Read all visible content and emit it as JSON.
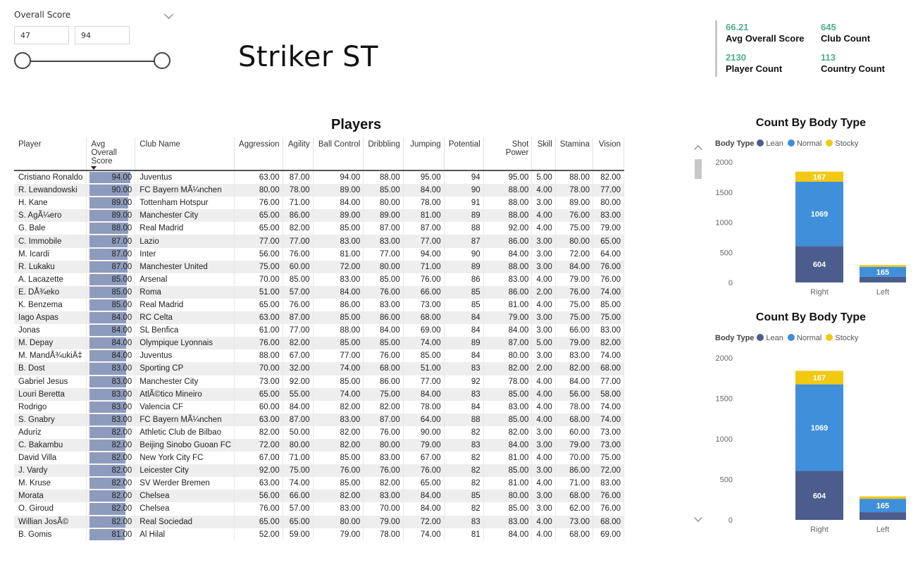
{
  "slicer": {
    "title": "Overall Score",
    "min": "47",
    "max": "94"
  },
  "page_title": "Striker ST",
  "kpis": [
    {
      "value": "66.21",
      "label": "Avg Overall Score"
    },
    {
      "value": "645",
      "label": "Club Count"
    },
    {
      "value": "2130",
      "label": "Player Count"
    },
    {
      "value": "113",
      "label": "Country Count"
    }
  ],
  "table": {
    "title": "Players",
    "score_max": 94,
    "columns": [
      "Player",
      "Avg Overall Score",
      "Club Name",
      "Aggression",
      "Agility",
      "Ball Control",
      "Dribbling",
      "Jumping",
      "Potential",
      "Shot Power",
      "Skill",
      "Stamina",
      "Vision"
    ],
    "rows": [
      [
        "Cristiano Ronaldo",
        "94.00",
        "Juventus",
        "63.00",
        "87.00",
        "94.00",
        "88.00",
        "95.00",
        "94",
        "95.00",
        "5.00",
        "88.00",
        "82.00"
      ],
      [
        "R. Lewandowski",
        "90.00",
        "FC Bayern MÃ¼nchen",
        "80.00",
        "78.00",
        "89.00",
        "85.00",
        "84.00",
        "90",
        "88.00",
        "4.00",
        "78.00",
        "77.00"
      ],
      [
        "H. Kane",
        "89.00",
        "Tottenham Hotspur",
        "76.00",
        "71.00",
        "84.00",
        "80.00",
        "78.00",
        "91",
        "88.00",
        "3.00",
        "89.00",
        "80.00"
      ],
      [
        "S. AgÃ¼ero",
        "89.00",
        "Manchester City",
        "65.00",
        "86.00",
        "89.00",
        "89.00",
        "81.00",
        "89",
        "88.00",
        "4.00",
        "76.00",
        "83.00"
      ],
      [
        "G. Bale",
        "88.00",
        "Real Madrid",
        "65.00",
        "82.00",
        "85.00",
        "87.00",
        "87.00",
        "88",
        "92.00",
        "4.00",
        "75.00",
        "79.00"
      ],
      [
        "C. Immobile",
        "87.00",
        "Lazio",
        "77.00",
        "77.00",
        "83.00",
        "83.00",
        "77.00",
        "87",
        "86.00",
        "3.00",
        "80.00",
        "65.00"
      ],
      [
        "M. Icardi",
        "87.00",
        "Inter",
        "56.00",
        "76.00",
        "81.00",
        "77.00",
        "94.00",
        "90",
        "84.00",
        "3.00",
        "72.00",
        "64.00"
      ],
      [
        "R. Lukaku",
        "87.00",
        "Manchester United",
        "75.00",
        "60.00",
        "72.00",
        "80.00",
        "71.00",
        "89",
        "88.00",
        "3.00",
        "84.00",
        "76.00"
      ],
      [
        "A. Lacazette",
        "85.00",
        "Arsenal",
        "70.00",
        "85.00",
        "83.00",
        "85.00",
        "76.00",
        "86",
        "83.00",
        "4.00",
        "79.00",
        "76.00"
      ],
      [
        "E. DÅ¾eko",
        "85.00",
        "Roma",
        "51.00",
        "57.00",
        "84.00",
        "76.00",
        "66.00",
        "85",
        "86.00",
        "2.00",
        "76.00",
        "74.00"
      ],
      [
        "K. Benzema",
        "85.00",
        "Real Madrid",
        "65.00",
        "76.00",
        "86.00",
        "83.00",
        "73.00",
        "85",
        "81.00",
        "4.00",
        "75.00",
        "85.00"
      ],
      [
        "Iago Aspas",
        "84.00",
        "RC Celta",
        "63.00",
        "87.00",
        "85.00",
        "86.00",
        "68.00",
        "84",
        "79.00",
        "3.00",
        "75.00",
        "75.00"
      ],
      [
        "Jonas",
        "84.00",
        "SL Benfica",
        "61.00",
        "77.00",
        "88.00",
        "84.00",
        "69.00",
        "84",
        "84.00",
        "3.00",
        "66.00",
        "83.00"
      ],
      [
        "M. Depay",
        "84.00",
        "Olympique Lyonnais",
        "76.00",
        "82.00",
        "85.00",
        "85.00",
        "74.00",
        "89",
        "87.00",
        "5.00",
        "79.00",
        "82.00"
      ],
      [
        "M. MandÅ¾ukiÄ‡",
        "84.00",
        "Juventus",
        "88.00",
        "67.00",
        "77.00",
        "76.00",
        "85.00",
        "84",
        "80.00",
        "3.00",
        "83.00",
        "74.00"
      ],
      [
        "B. Dost",
        "83.00",
        "Sporting CP",
        "70.00",
        "32.00",
        "74.00",
        "68.00",
        "51.00",
        "83",
        "82.00",
        "2.00",
        "82.00",
        "68.00"
      ],
      [
        "Gabriel Jesus",
        "83.00",
        "Manchester City",
        "73.00",
        "92.00",
        "85.00",
        "86.00",
        "77.00",
        "92",
        "78.00",
        "4.00",
        "84.00",
        "77.00"
      ],
      [
        "Louri Beretta",
        "83.00",
        "AtlÃ©tico Mineiro",
        "65.00",
        "55.00",
        "74.00",
        "75.00",
        "84.00",
        "83",
        "85.00",
        "4.00",
        "56.00",
        "58.00"
      ],
      [
        "Rodrigo",
        "83.00",
        "Valencia CF",
        "60.00",
        "84.00",
        "82.00",
        "82.00",
        "78.00",
        "84",
        "83.00",
        "4.00",
        "78.00",
        "74.00"
      ],
      [
        "S. Gnabry",
        "83.00",
        "FC Bayern MÃ¼nchen",
        "63.00",
        "87.00",
        "83.00",
        "87.00",
        "64.00",
        "88",
        "85.00",
        "4.00",
        "68.00",
        "74.00"
      ],
      [
        "Aduriz",
        "82.00",
        "Athletic Club de Bilbao",
        "82.00",
        "50.00",
        "82.00",
        "76.00",
        "90.00",
        "82",
        "82.00",
        "3.00",
        "60.00",
        "73.00"
      ],
      [
        "C. Bakambu",
        "82.00",
        "Beijing Sinobo Guoan FC",
        "72.00",
        "80.00",
        "82.00",
        "80.00",
        "79.00",
        "83",
        "84.00",
        "3.00",
        "79.00",
        "73.00"
      ],
      [
        "David Villa",
        "82.00",
        "New York City FC",
        "67.00",
        "71.00",
        "85.00",
        "83.00",
        "67.00",
        "82",
        "81.00",
        "4.00",
        "70.00",
        "75.00"
      ],
      [
        "J. Vardy",
        "82.00",
        "Leicester City",
        "92.00",
        "75.00",
        "76.00",
        "76.00",
        "76.00",
        "82",
        "85.00",
        "3.00",
        "86.00",
        "72.00"
      ],
      [
        "M. Kruse",
        "82.00",
        "SV Werder Bremen",
        "63.00",
        "74.00",
        "85.00",
        "82.00",
        "65.00",
        "82",
        "81.00",
        "4.00",
        "71.00",
        "83.00"
      ],
      [
        "Morata",
        "82.00",
        "Chelsea",
        "56.00",
        "66.00",
        "82.00",
        "83.00",
        "84.00",
        "85",
        "80.00",
        "3.00",
        "68.00",
        "76.00"
      ],
      [
        "O. Giroud",
        "82.00",
        "Chelsea",
        "76.00",
        "57.00",
        "83.00",
        "70.00",
        "84.00",
        "82",
        "85.00",
        "3.00",
        "62.00",
        "76.00"
      ],
      [
        "Willian JosÃ©",
        "82.00",
        "Real Sociedad",
        "65.00",
        "65.00",
        "80.00",
        "79.00",
        "72.00",
        "83",
        "83.00",
        "4.00",
        "73.00",
        "68.00"
      ],
      [
        "B. Gomis",
        "81.00",
        "Al Hilal",
        "52.00",
        "59.00",
        "79.00",
        "78.00",
        "74.00",
        "81",
        "84.00",
        "4.00",
        "68.00",
        "69.00"
      ]
    ]
  },
  "charts": [
    {
      "title": "Count By Body Type"
    },
    {
      "title": "Count By Body Type"
    }
  ],
  "chart_data": [
    {
      "type": "bar",
      "stacked": true,
      "title": "Count By Body Type",
      "legend_title": "Body Type",
      "legend_position": "top-left",
      "categories": [
        "Right",
        "Left"
      ],
      "ylim": [
        0,
        2000
      ],
      "yticks": [
        0,
        500,
        1000,
        1500,
        2000
      ],
      "series": [
        {
          "name": "Lean",
          "color": "#4b5d8c",
          "values": [
            604,
            95
          ]
        },
        {
          "name": "Normal",
          "color": "#3f8fdb",
          "values": [
            1069,
            165
          ]
        },
        {
          "name": "Stocky",
          "color": "#f2c811",
          "values": [
            167,
            30
          ]
        }
      ],
      "data_labels": [
        [
          604,
          null
        ],
        [
          1069,
          165
        ],
        [
          167,
          null
        ]
      ]
    },
    {
      "type": "bar",
      "stacked": true,
      "title": "Count By Body Type",
      "legend_title": "Body Type",
      "legend_position": "top-left",
      "categories": [
        "Right",
        "Left"
      ],
      "ylim": [
        0,
        2000
      ],
      "yticks": [
        0,
        500,
        1000,
        1500,
        2000
      ],
      "series": [
        {
          "name": "Lean",
          "color": "#4b5d8c",
          "values": [
            604,
            95
          ]
        },
        {
          "name": "Normal",
          "color": "#3f8fdb",
          "values": [
            1069,
            165
          ]
        },
        {
          "name": "Stocky",
          "color": "#f2c811",
          "values": [
            167,
            30
          ]
        }
      ],
      "data_labels": [
        [
          604,
          null
        ],
        [
          1069,
          165
        ],
        [
          167,
          null
        ]
      ]
    }
  ]
}
